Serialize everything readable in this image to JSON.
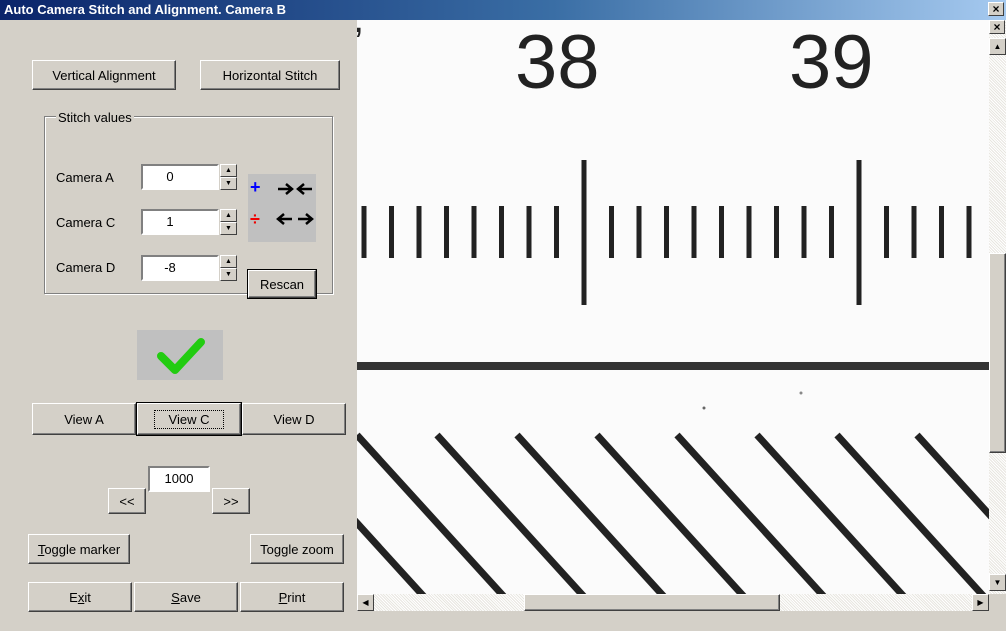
{
  "window": {
    "title": "Auto Camera Stitch and Alignment.  Camera B",
    "close_glyph": "×"
  },
  "toolbar": {
    "vertical_alignment": "Vertical Alignment",
    "horizontal_stitch": "Horizontal Stitch"
  },
  "stitch": {
    "group_label": "Stitch values",
    "cameras": [
      {
        "label": "Camera A",
        "value": "0"
      },
      {
        "label": "Camera C",
        "value": "1"
      },
      {
        "label": "Camera D",
        "value": "-8"
      }
    ],
    "plus": "+",
    "divide": "÷",
    "rescan": "Rescan"
  },
  "status": {
    "icon": "check-icon",
    "color": "#22cc11"
  },
  "views": {
    "a": "View A",
    "c": "View C",
    "d": "View D"
  },
  "frame": {
    "prev": "<<",
    "value": "1000",
    "next": ">>"
  },
  "actions": {
    "toggle_marker_key": "T",
    "toggle_marker_rest": "oggle marker",
    "toggle_zoom": "Toggle zoom",
    "exit_pre": "E",
    "exit_key": "x",
    "exit_post": "it",
    "save_key": "S",
    "save_rest": "ave",
    "print_key": "P",
    "print_rest": "rint"
  },
  "viewer": {
    "scale_numbers": [
      "38",
      "39"
    ],
    "vertical_scroll": 0.62,
    "horizontal_scroll": 0.44
  }
}
